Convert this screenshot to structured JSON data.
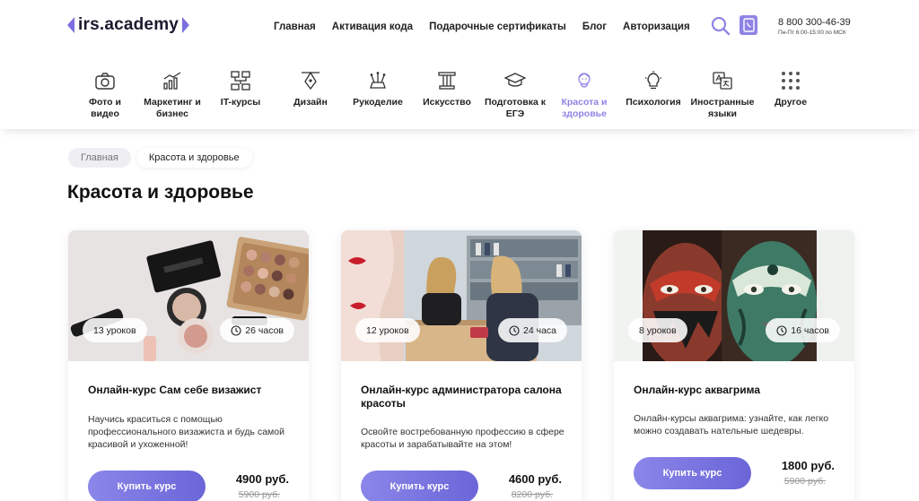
{
  "header": {
    "logo_text": "irs.academy",
    "nav": [
      "Главная",
      "Активация кода",
      "Подарочные сертификаты",
      "Блог",
      "Авторизация"
    ],
    "phone": "8 800 300-46-39",
    "hours": "Пн-Пт 6:00-15:00 по МСК",
    "accent_color": "#8e84e6"
  },
  "categories": [
    {
      "label": "Фото и видео",
      "icon": "camera-icon"
    },
    {
      "label": "Маркетинг и бизнес",
      "icon": "chart-icon"
    },
    {
      "label": "IT-курсы",
      "icon": "network-icon"
    },
    {
      "label": "Дизайн",
      "icon": "pen-tool-icon"
    },
    {
      "label": "Рукоделие",
      "icon": "crafts-icon"
    },
    {
      "label": "Искусство",
      "icon": "column-icon"
    },
    {
      "label": "Подготовка к ЕГЭ",
      "icon": "graduation-cap-icon"
    },
    {
      "label": "Красота и здоровье",
      "icon": "beauty-face-icon",
      "active": true
    },
    {
      "label": "Психология",
      "icon": "lightbulb-icon"
    },
    {
      "label": "Иностранные языки",
      "icon": "translate-icon"
    },
    {
      "label": "Другое",
      "icon": "grid-dots-icon"
    }
  ],
  "breadcrumb": {
    "home": "Главная",
    "current": "Красота и здоровье"
  },
  "page_title": "Красота и здоровье",
  "courses": [
    {
      "lessons": "13 уроков",
      "hours": "26 часов",
      "title": "Онлайн-курс Сам себе визажист",
      "description": "Научись краситься с помощью профессионального визажиста и будь самой красивой и ухоженной!",
      "button": "Купить курс",
      "price": "4900 руб.",
      "old_price": "5900 руб."
    },
    {
      "lessons": "12 уроков",
      "hours": "24 часа",
      "title": "Онлайн-курс администратора салона красоты",
      "description": "Освойте востребованную профессию в сфере красоты и зарабатывайте на этом!",
      "button": "Купить курс",
      "price": "4600 руб.",
      "old_price": "8200 руб."
    },
    {
      "lessons": "8 уроков",
      "hours": "16 часов",
      "title": "Онлайн-курс аквагрима",
      "description": "Онлайн-курсы аквагрима: узнайте, как легко можно создавать нательные шедевры.",
      "button": "Купить курс",
      "price": "1800 руб.",
      "old_price": "5900 руб."
    }
  ]
}
